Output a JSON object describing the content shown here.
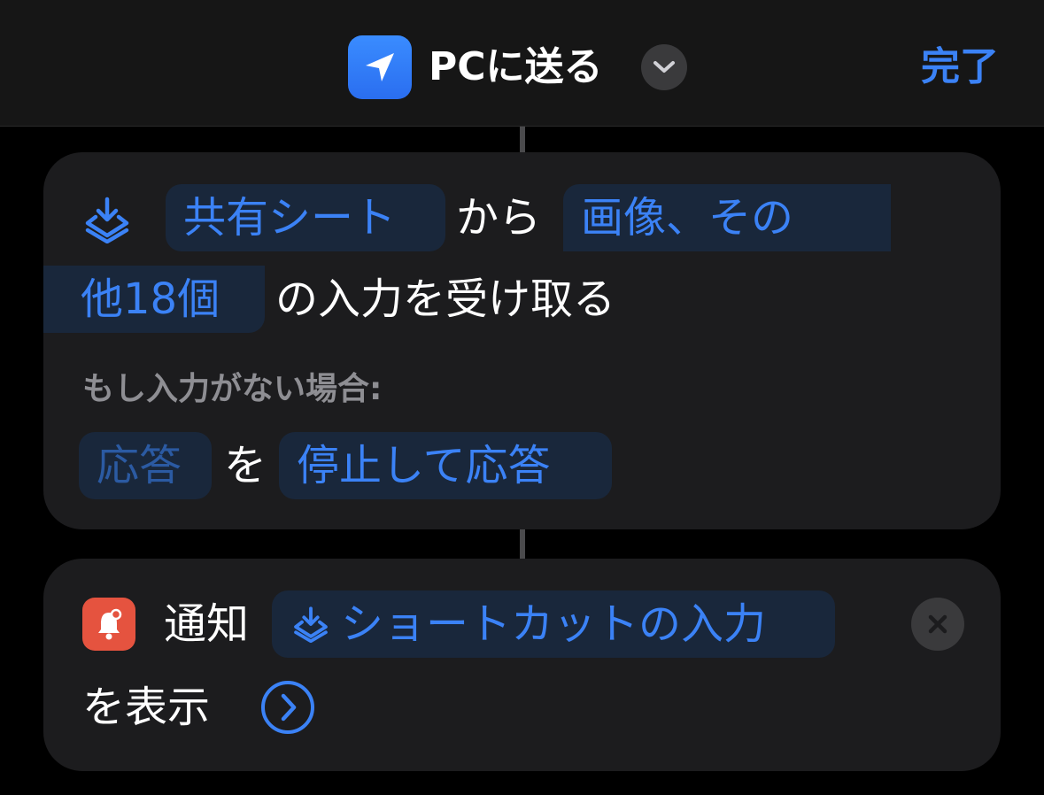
{
  "header": {
    "app_icon": "location-arrow-icon",
    "title": "PCに送る",
    "title_menu_icon": "chevron-down-icon",
    "done_label": "完了"
  },
  "receive_action": {
    "icon": "shortcut-input-icon",
    "source": "共有シート",
    "from_text": "から",
    "types_line1": "画像、その",
    "types_line2": "他18個",
    "suffix": "の入力を受け取る",
    "if_no_input_label": "もし入力がない場合:",
    "response": "応答",
    "wo_text": "を",
    "behavior": "停止して応答"
  },
  "notify_action": {
    "icon": "bell-icon",
    "label": "通知",
    "variable_icon": "shortcut-input-icon",
    "variable": "ショートカットの入力",
    "suffix": "を表示",
    "expand_icon": "chevron-right-circle-icon",
    "remove_icon": "close-icon"
  },
  "colors": {
    "accent": "#3b82f6",
    "card": "#1c1c1e",
    "pill": "#19273b",
    "notify_icon_bg": "#e5533f"
  }
}
